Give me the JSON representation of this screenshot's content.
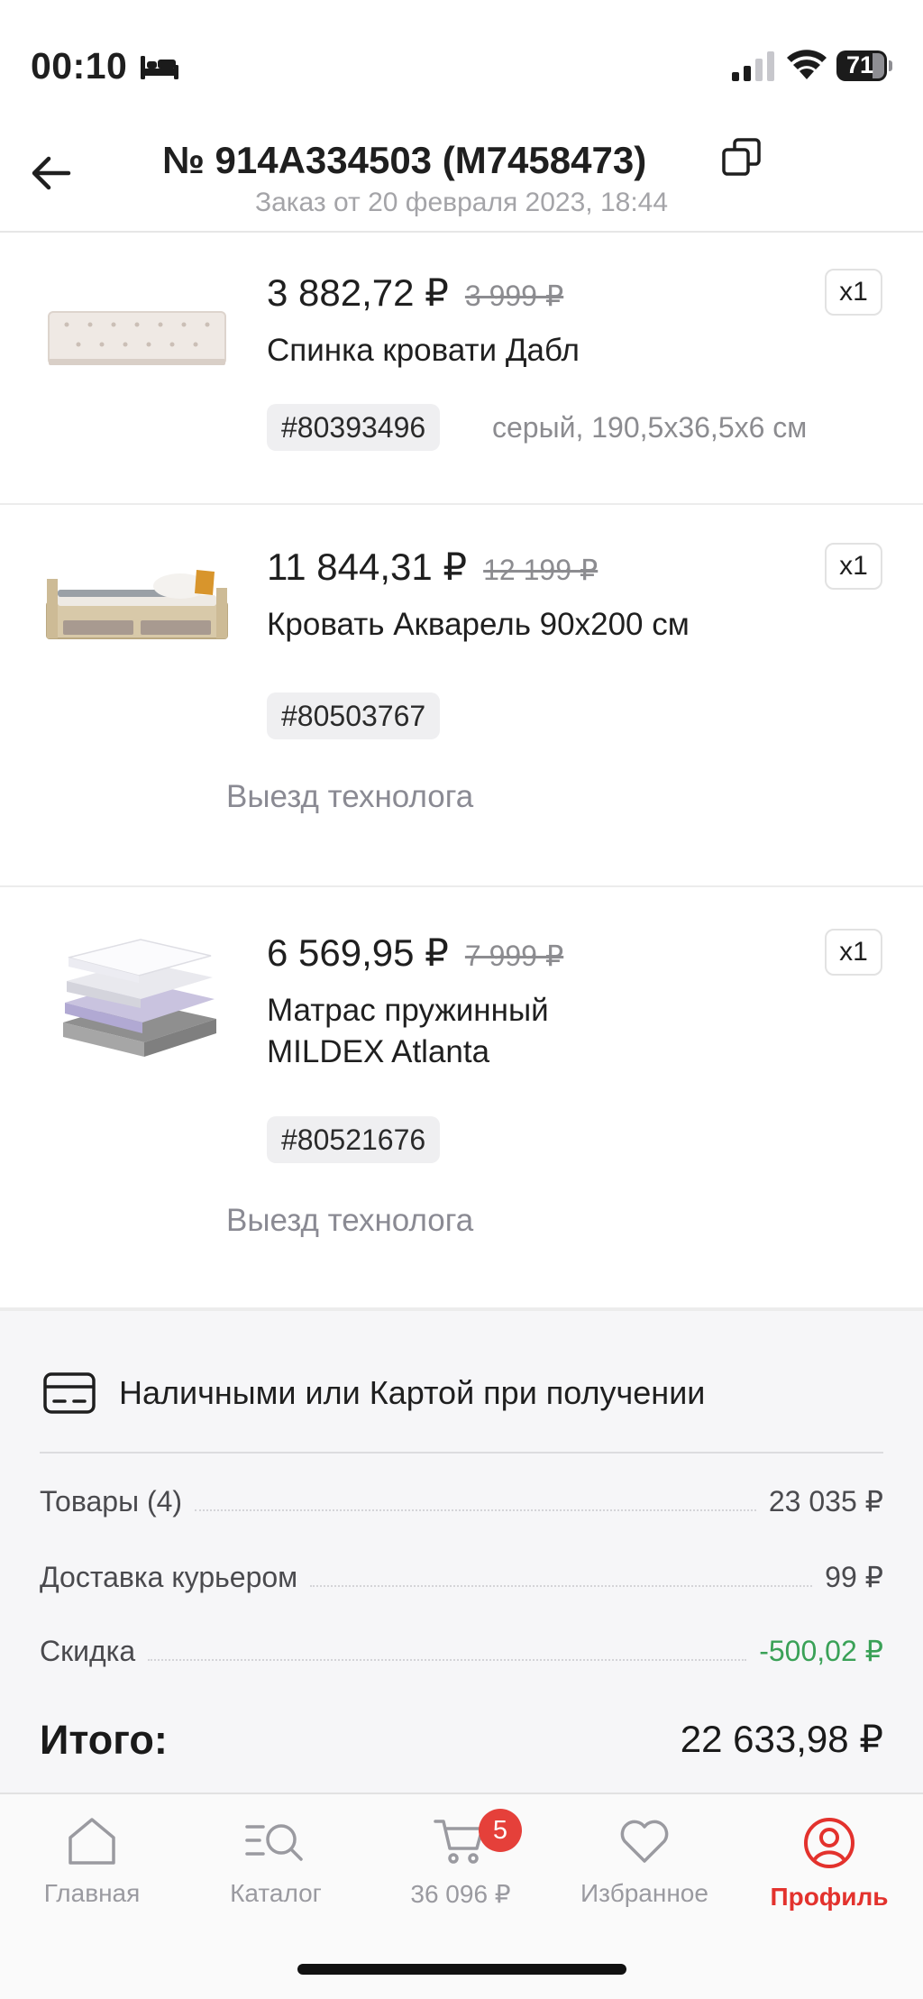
{
  "status_bar": {
    "time": "00:10",
    "battery": "71"
  },
  "header": {
    "title": "№ 914A334503 (M7458473)",
    "subtitle": "Заказ от 20 февраля 2023, 18:44"
  },
  "products": [
    {
      "price": "3 882,72 ₽",
      "old_price": "3 999 ₽",
      "name": "Спинка кровати Дабл",
      "sku": "#80393496",
      "attributes": "серый, 190,5х36,5х6 см",
      "qty": "x1"
    },
    {
      "price": "11 844,31 ₽",
      "old_price": "12 199 ₽",
      "name": "Кровать Акварель 90х200 см",
      "sku": "#80503767",
      "service": "Выезд технолога",
      "qty": "x1"
    },
    {
      "price": "6 569,95 ₽",
      "old_price": "7 999 ₽",
      "name": "Матрас пружинный MILDEX Atlanta",
      "sku": "#80521676",
      "service": "Выезд технолога",
      "qty": "x1"
    }
  ],
  "summary": {
    "payment_method": "Наличными или Картой при получении",
    "lines": [
      {
        "label": "Товары (4)",
        "value": "23 035 ₽"
      },
      {
        "label": "Доставка курьером",
        "value": "99 ₽"
      },
      {
        "label": "Скидка",
        "value": "-500,02 ₽"
      }
    ],
    "total_label": "Итого:",
    "total_value": "22 633,98 ₽",
    "discount_color": "#3aa157"
  },
  "tabbar": {
    "items": [
      {
        "label": "Главная",
        "icon": "home-icon"
      },
      {
        "label": "Каталог",
        "icon": "catalog-search-icon"
      },
      {
        "label": "36 096 ₽",
        "icon": "cart-icon",
        "badge": "5"
      },
      {
        "label": "Избранное",
        "icon": "heart-icon"
      },
      {
        "label": "Профиль",
        "icon": "profile-icon",
        "active": true
      }
    ],
    "active_color": "#e3322d"
  }
}
